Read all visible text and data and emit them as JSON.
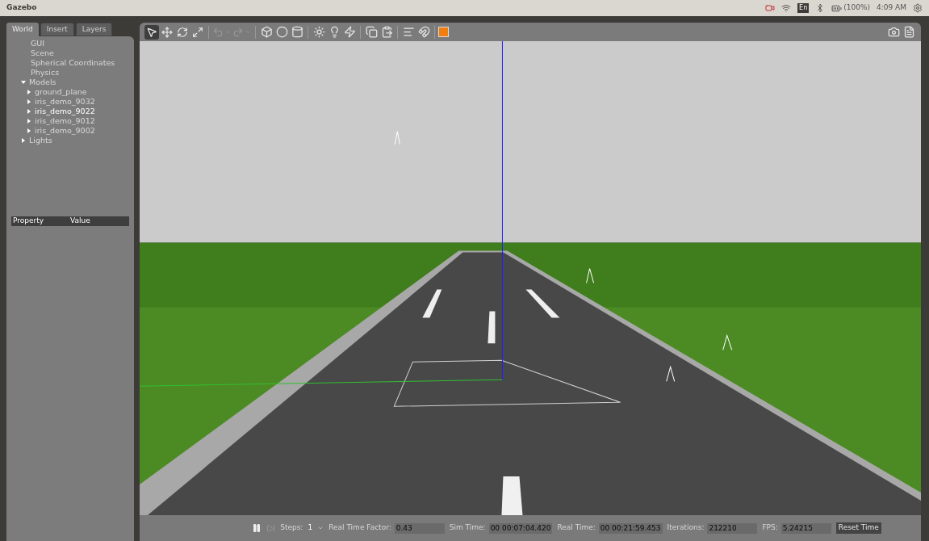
{
  "top_bar": {
    "title": "Gazebo",
    "language": "En",
    "battery": "(100%)",
    "time": "4:09 AM"
  },
  "tabs": [
    {
      "label": "World",
      "selected": true
    },
    {
      "label": "Insert",
      "selected": false
    },
    {
      "label": "Layers",
      "selected": false
    }
  ],
  "tree": [
    {
      "label": "GUI",
      "selected": false
    },
    {
      "label": "Scene",
      "selected": false
    },
    {
      "label": "Spherical Coordinates",
      "selected": false
    },
    {
      "label": "Physics",
      "selected": false
    },
    {
      "label": "Models",
      "selected": false,
      "expanded": true,
      "children": [
        {
          "label": "ground_plane",
          "selected": false,
          "expanded": false
        },
        {
          "label": "iris_demo_9032",
          "selected": false,
          "expanded": false
        },
        {
          "label": "iris_demo_9022",
          "selected": true,
          "expanded": false
        },
        {
          "label": "iris_demo_9012",
          "selected": false,
          "expanded": false
        },
        {
          "label": "iris_demo_9002",
          "selected": false,
          "expanded": false
        }
      ]
    },
    {
      "label": "Lights",
      "selected": false,
      "expanded": false
    }
  ],
  "properties": {
    "columns": [
      "Property",
      "Value"
    ]
  },
  "toolbar": {
    "tools": [
      {
        "kind": "select",
        "selected": true
      },
      {
        "kind": "translate",
        "selected": false
      },
      {
        "kind": "rotate",
        "selected": false
      },
      {
        "kind": "scale",
        "selected": false
      }
    ]
  },
  "status_bar": {
    "paused": false,
    "steps_label": "Steps:",
    "steps": "1",
    "fields": [
      {
        "label": "Real Time Factor:",
        "value": "0.43"
      },
      {
        "label": "Sim Time:",
        "value": "00 00:07:04.420"
      },
      {
        "label": "Real Time:",
        "value": "00 00:21:59.453"
      },
      {
        "label": "Iterations:",
        "value": "212210"
      },
      {
        "label": "FPS:",
        "value": "5.24215"
      }
    ],
    "reset": "Reset Time"
  }
}
